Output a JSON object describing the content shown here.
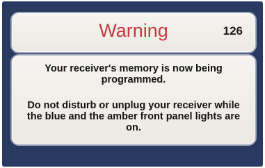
{
  "dialog": {
    "title": "Warning",
    "code": "126",
    "message_1": "Your receiver's memory is now being programmed.",
    "message_2": "Do not disturb or unplug your receiver while the blue and the amber front panel lights are on."
  },
  "colors": {
    "background": "#283a60",
    "panel": "#f2f0eb",
    "title": "#c23a3f",
    "text": "#111111"
  }
}
